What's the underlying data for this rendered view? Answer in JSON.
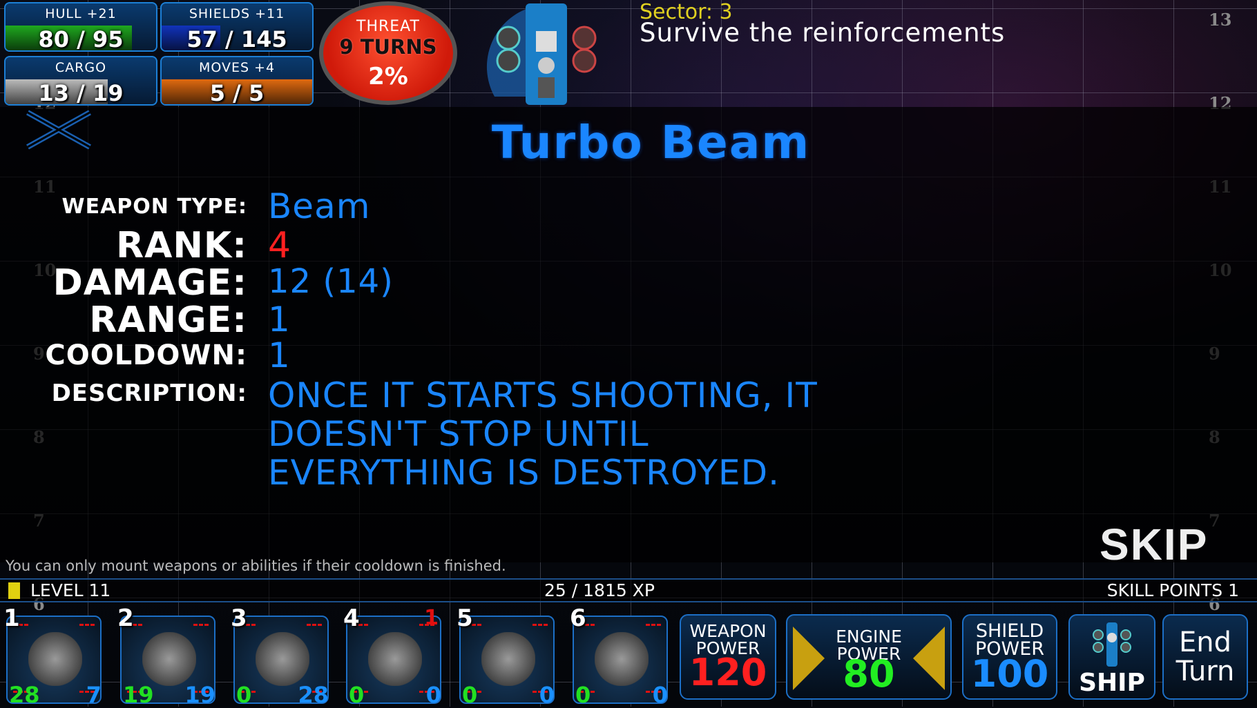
{
  "stats": {
    "hull": {
      "label": "HULL +21",
      "value": "80 / 95",
      "fill": 0.84,
      "color": "#1fa81f"
    },
    "shields": {
      "label": "SHIELDS +11",
      "value": "57 / 145",
      "fill": 0.39,
      "color": "#1133bb"
    },
    "cargo": {
      "label": "CARGO",
      "value": "13 / 19",
      "fill": 0.68,
      "color": "#bbbbbb"
    },
    "moves": {
      "label": "MOVES +4",
      "value": "5 / 5",
      "fill": 1.0,
      "color": "#e06a10"
    }
  },
  "threat": {
    "label": "THREAT",
    "turns": "9 TURNS",
    "percent": "2%"
  },
  "mission": {
    "sector": "Sector: 3",
    "objective": "Survive the reinforcements"
  },
  "grid_rows": [
    "13",
    "12",
    "11",
    "10",
    "9",
    "8",
    "7",
    "6"
  ],
  "weapon": {
    "name": "Turbo Beam",
    "type_label": "WEAPON TYPE:",
    "type": "Beam",
    "rank_label": "RANK:",
    "rank": "4",
    "damage_label": "DAMAGE:",
    "damage": "12 (14)",
    "range_label": "RANGE:",
    "range": "1",
    "cooldown_label": "COOLDOWN:",
    "cooldown": "1",
    "description_label": "DESCRIPTION:",
    "description": [
      "ONCE IT STARTS SHOOTING, IT",
      "DOESN'T STOP UNTIL",
      "EVERYTHING IS DESTROYED."
    ]
  },
  "skip_label": "SKIP",
  "hint": "You can only mount weapons or abilities if their cooldown is finished.",
  "level": {
    "label": "LEVEL 11",
    "xp": "25 / 1815 XP",
    "skill_points": "SKILL POINTS  1"
  },
  "slots": [
    {
      "num": "1",
      "green": "28",
      "blue": "7",
      "red": ""
    },
    {
      "num": "2",
      "green": "19",
      "blue": "19",
      "red": ""
    },
    {
      "num": "3",
      "green": "0",
      "blue": "28",
      "red": ""
    },
    {
      "num": "4",
      "green": "0",
      "blue": "0",
      "red": "1"
    },
    {
      "num": "5",
      "green": "0",
      "blue": "0",
      "red": ""
    },
    {
      "num": "6",
      "green": "0",
      "blue": "0",
      "red": ""
    }
  ],
  "power": {
    "weapon": {
      "label": "WEAPON POWER",
      "value": "120",
      "color": "#ff2020"
    },
    "engine": {
      "label": "ENGINE POWER",
      "value": "80",
      "color": "#22ee22"
    },
    "shield": {
      "label": "SHIELD POWER",
      "value": "100",
      "color": "#1a8cff"
    }
  },
  "ship_button": "SHIP",
  "end_turn": "End Turn"
}
